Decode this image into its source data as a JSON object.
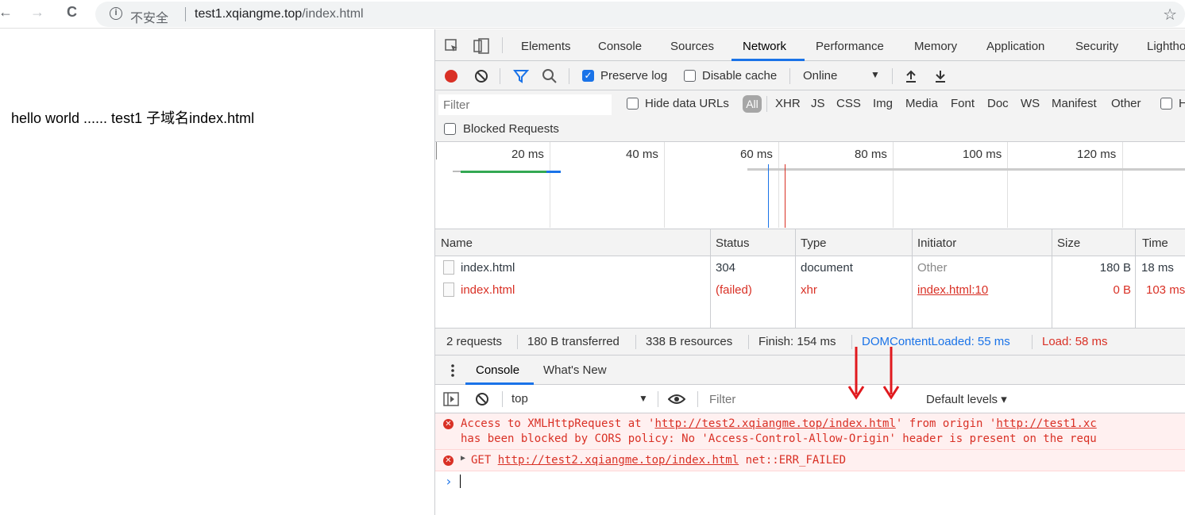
{
  "browser": {
    "back_glyph": "←",
    "forward_glyph": "→",
    "reload_glyph": "C",
    "security_label": "不安全",
    "url_host": "test1.xqiangme.top",
    "url_path": "/index.html",
    "star_glyph": "☆",
    "info_glyph": "i"
  },
  "page": {
    "text": "hello world ...... test1 子域名index.html"
  },
  "devtools": {
    "tabs": [
      "Elements",
      "Console",
      "Sources",
      "Network",
      "Performance",
      "Memory",
      "Application",
      "Security",
      "Lightho"
    ],
    "active_tab": "Network",
    "toolbar": {
      "preserve_log": "Preserve log",
      "preserve_log_checked": true,
      "disable_cache": "Disable cache",
      "disable_cache_checked": false,
      "throttle": "Online"
    },
    "filter": {
      "placeholder": "Filter",
      "hide_data_urls": "Hide data URLs",
      "all": "All",
      "types": [
        "XHR",
        "JS",
        "CSS",
        "Img",
        "Media",
        "Font",
        "Doc",
        "WS",
        "Manifest",
        "Other"
      ],
      "trailing_checkbox_label": "H",
      "blocked_requests": "Blocked Requests"
    },
    "overview": {
      "tick_labels": [
        "20 ms",
        "40 ms",
        "60 ms",
        "80 ms",
        "100 ms",
        "120 ms"
      ]
    },
    "table": {
      "columns": [
        "Name",
        "Status",
        "Type",
        "Initiator",
        "Size",
        "Time"
      ],
      "rows": [
        {
          "name": "index.html",
          "status": "304",
          "type": "document",
          "initiator": "Other",
          "size": "180 B",
          "time": "18 ms",
          "failed": false
        },
        {
          "name": "index.html",
          "status": "(failed)",
          "type": "xhr",
          "initiator": "index.html:10",
          "size": "0 B",
          "time": "103 ms",
          "failed": true
        }
      ]
    },
    "summary": {
      "requests": "2 requests",
      "transferred": "180 B transferred",
      "resources": "338 B resources",
      "finish": "Finish: 154 ms",
      "dom_content_loaded": "DOMContentLoaded: 55 ms",
      "load": "Load: 58 ms"
    },
    "drawer": {
      "tabs": [
        "Console",
        "What's New"
      ],
      "active_tab": "Console",
      "context": "top",
      "filter_placeholder": "Filter",
      "levels": "Default levels ▾"
    },
    "console": {
      "error1_line1_prefix": "Access to XMLHttpRequest at '",
      "error1_url1": "http://test2.xqiangme.top/index.html",
      "error1_line1_mid": "' from origin '",
      "error1_url2": "http://test1.xc",
      "error1_line2": "has been blocked by CORS policy: No 'Access-Control-Allow-Origin' header is present on the requ",
      "error2_prefix": "GET ",
      "error2_url": "http://test2.xqiangme.top/index.html",
      "error2_suffix": " net::ERR_FAILED",
      "prompt": "›"
    }
  },
  "colors": {
    "accent": "#1a73e8",
    "error": "#d93025",
    "error_bg": "#fff0f0",
    "annotation_arrow": "#e0191e"
  }
}
